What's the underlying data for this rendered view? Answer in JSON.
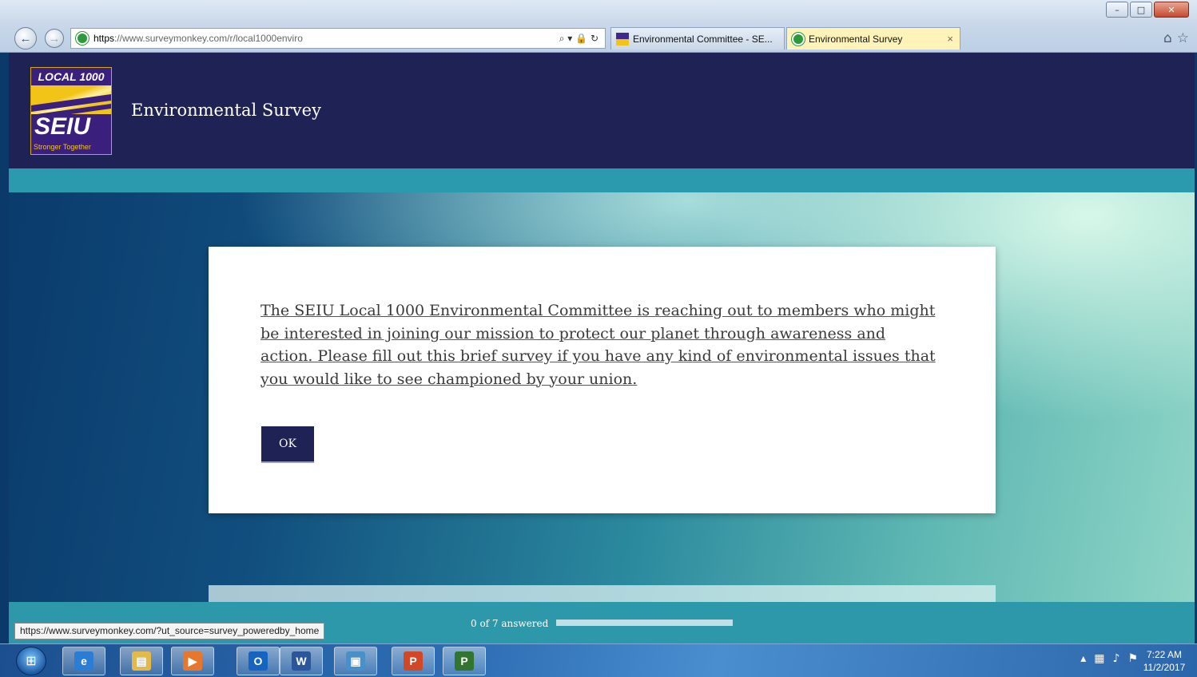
{
  "browser": {
    "url_scheme": "https",
    "url_rest": "://www.surveymonkey.com/r/local1000enviro",
    "tabs": [
      {
        "label": "Environmental Committee - SE...",
        "active": false
      },
      {
        "label": "Environmental Survey",
        "active": true
      }
    ],
    "tab_close_glyph": "×",
    "status_url": "https://www.surveymonkey.com/?ut_source=survey_poweredby_home"
  },
  "logo": {
    "top": "LOCAL 1000",
    "name": "SEIU",
    "tagline": "Stronger Together"
  },
  "survey": {
    "title": "Environmental Survey",
    "intro": "The SEIU Local 1000 Environmental Committee is reaching out to members who might be interested in joining our mission to protect our planet through awareness and action. Please fill out this brief survey if you have any kind of environmental issues that you would like to see championed by your union.",
    "ok_label": "OK",
    "progress_text": "0 of 7 answered",
    "answered": 0,
    "total": 7
  },
  "taskbar": {
    "time": "7:22 AM",
    "date": "11/2/2017",
    "apps": [
      {
        "name": "internet-explorer-icon",
        "glyph": "e",
        "color": "#2b7cd3"
      },
      {
        "name": "file-explorer-icon",
        "glyph": "▤",
        "color": "#e3b94a"
      },
      {
        "name": "media-player-icon",
        "glyph": "▶",
        "color": "#e8772e"
      },
      {
        "name": "outlook-icon",
        "glyph": "O",
        "color": "#1565c0"
      },
      {
        "name": "word-icon",
        "glyph": "W",
        "color": "#2b579a"
      },
      {
        "name": "photo-viewer-icon",
        "glyph": "▣",
        "color": "#4a90c8"
      },
      {
        "name": "powerpoint-icon",
        "glyph": "P",
        "color": "#d24726"
      },
      {
        "name": "project-icon",
        "glyph": "P",
        "color": "#31752f"
      }
    ]
  },
  "colors": {
    "header_bg": "#1f2255",
    "accent_teal": "#2e98ab",
    "button_bg": "#1f2255"
  }
}
